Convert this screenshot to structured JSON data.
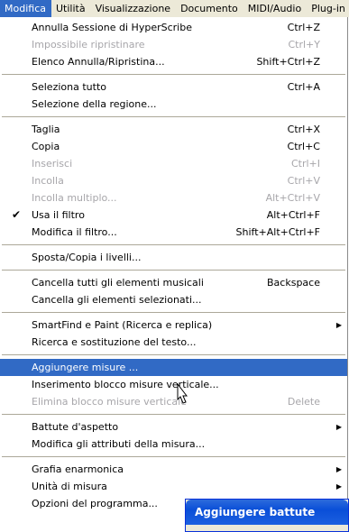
{
  "menubar": {
    "items": [
      {
        "label": "Modifica",
        "active": true
      },
      {
        "label": "Utilità"
      },
      {
        "label": "Visualizzazione"
      },
      {
        "label": "Documento"
      },
      {
        "label": "MIDI/Audio"
      },
      {
        "label": "Plug-in"
      }
    ]
  },
  "menu": {
    "groups": [
      [
        {
          "label": "Annulla Sessione di HyperScribe",
          "shortcut": "Ctrl+Z"
        },
        {
          "label": "Impossibile ripristinare",
          "shortcut": "Ctrl+Y",
          "disabled": true
        },
        {
          "label": "Elenco Annulla/Ripristina...",
          "shortcut": "Shift+Ctrl+Z"
        }
      ],
      [
        {
          "label": "Seleziona tutto",
          "shortcut": "Ctrl+A"
        },
        {
          "label": "Selezione della regione..."
        }
      ],
      [
        {
          "label": "Taglia",
          "shortcut": "Ctrl+X"
        },
        {
          "label": "Copia",
          "shortcut": "Ctrl+C"
        },
        {
          "label": "Inserisci",
          "shortcut": "Ctrl+I",
          "disabled": true
        },
        {
          "label": "Incolla",
          "shortcut": "Ctrl+V",
          "disabled": true
        },
        {
          "label": "Incolla multiplo...",
          "shortcut": "Alt+Ctrl+V",
          "disabled": true
        },
        {
          "label": "Usa il filtro",
          "shortcut": "Alt+Ctrl+F",
          "checked": true
        },
        {
          "label": "Modifica il filtro...",
          "shortcut": "Shift+Alt+Ctrl+F"
        }
      ],
      [
        {
          "label": "Sposta/Copia i livelli..."
        }
      ],
      [
        {
          "label": "Cancella tutti gli elementi musicali",
          "shortcut": "Backspace"
        },
        {
          "label": "Cancella gli elementi selezionati..."
        }
      ],
      [
        {
          "label": "SmartFind e Paint (Ricerca e replica)",
          "submenu": true
        },
        {
          "label": "Ricerca e sostituzione del testo..."
        }
      ],
      [
        {
          "label": "Aggiungere misure ...",
          "highlighted": true
        },
        {
          "label": "Inserimento blocco misure verticale..."
        },
        {
          "label": "Elimina blocco misure verticale",
          "shortcut": "Delete",
          "disabled": true
        }
      ],
      [
        {
          "label": "Battute d'aspetto",
          "submenu": true
        },
        {
          "label": "Modifica gli attributi della misura..."
        }
      ],
      [
        {
          "label": "Grafia enarmonica",
          "submenu": true
        },
        {
          "label": "Unità di misura",
          "submenu": true
        },
        {
          "label": "Opzioni del programma..."
        }
      ]
    ]
  },
  "dialog": {
    "title": "Aggiungere battute"
  },
  "icons": {
    "check": "✔",
    "submenu_arrow": "▶"
  },
  "colors": {
    "highlight": "#316ac5",
    "disabled": "#a7a6aa",
    "menubar_bg": "#ece9d8"
  }
}
